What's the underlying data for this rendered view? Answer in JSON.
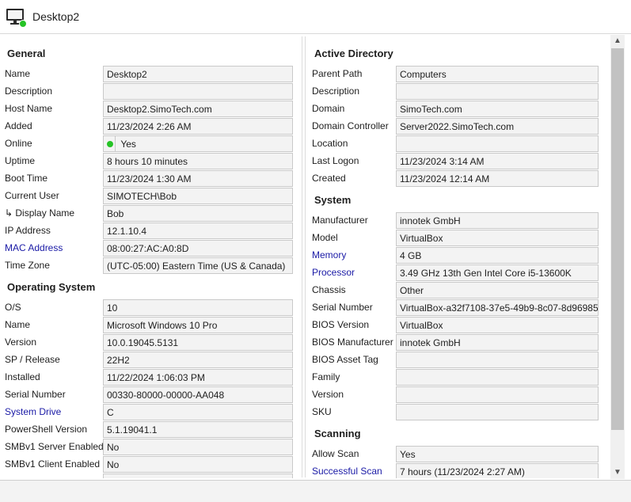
{
  "window": {
    "title": "Desktop2",
    "icon": "computer-online-icon"
  },
  "general": {
    "title": "General",
    "rows": [
      {
        "label": "Name",
        "value": "Desktop2"
      },
      {
        "label": "Description",
        "value": ""
      },
      {
        "label": "Host Name",
        "value": "Desktop2.SimoTech.com"
      },
      {
        "label": "Added",
        "value": "11/23/2024 2:26 AM"
      },
      {
        "label": "Online",
        "value": "Yes"
      },
      {
        "label": "Uptime",
        "value": "8 hours 10 minutes"
      },
      {
        "label": "Boot Time",
        "value": "11/23/2024 1:30 AM"
      },
      {
        "label": "Current User",
        "value": "SIMOTECH\\Bob"
      },
      {
        "label": "↳ Display Name",
        "value": "Bob"
      },
      {
        "label": "IP Address",
        "value": "12.1.10.4"
      },
      {
        "label": "MAC Address",
        "value": "08:00:27:AC:A0:8D"
      },
      {
        "label": "Time Zone",
        "value": "(UTC-05:00) Eastern Time (US & Canada)"
      }
    ]
  },
  "os": {
    "title": "Operating System",
    "rows": [
      {
        "label": "O/S",
        "value": "10"
      },
      {
        "label": "Name",
        "value": "Microsoft Windows 10 Pro"
      },
      {
        "label": "Version",
        "value": "10.0.19045.5131"
      },
      {
        "label": "SP / Release",
        "value": "22H2"
      },
      {
        "label": "Installed",
        "value": "11/22/2024 1:06:03 PM"
      },
      {
        "label": "Serial Number",
        "value": "00330-80000-00000-AA048"
      },
      {
        "label": "System Drive",
        "value": "C"
      },
      {
        "label": "PowerShell Version",
        "value": "5.1.19041.1"
      },
      {
        "label": "SMBv1 Server Enabled",
        "value": "No"
      },
      {
        "label": "SMBv1 Client Enabled",
        "value": "No"
      }
    ]
  },
  "active_directory": {
    "title": "Active Directory",
    "rows": [
      {
        "label": "Parent Path",
        "value": "Computers"
      },
      {
        "label": "Description",
        "value": ""
      },
      {
        "label": "Domain",
        "value": "SimoTech.com"
      },
      {
        "label": "Domain Controller",
        "value": "Server2022.SimoTech.com"
      },
      {
        "label": "Location",
        "value": ""
      },
      {
        "label": "Last Logon",
        "value": "11/23/2024 3:14 AM"
      },
      {
        "label": "Created",
        "value": "11/23/2024 12:14 AM"
      }
    ]
  },
  "system": {
    "title": "System",
    "rows": [
      {
        "label": "Manufacturer",
        "value": "innotek GmbH"
      },
      {
        "label": "Model",
        "value": "VirtualBox"
      },
      {
        "label": "Memory",
        "value": "4 GB"
      },
      {
        "label": "Processor",
        "value": "3.49 GHz 13th Gen Intel Core i5-13600K"
      },
      {
        "label": "Chassis",
        "value": "Other"
      },
      {
        "label": "Serial Number",
        "value": "VirtualBox-a32f7108-37e5-49b9-8c07-8d96985"
      },
      {
        "label": "BIOS Version",
        "value": "VirtualBox"
      },
      {
        "label": "BIOS Manufacturer",
        "value": "innotek GmbH"
      },
      {
        "label": "BIOS Asset Tag",
        "value": ""
      },
      {
        "label": "Family",
        "value": ""
      },
      {
        "label": "Version",
        "value": ""
      },
      {
        "label": "SKU",
        "value": ""
      }
    ]
  },
  "scanning": {
    "title": "Scanning",
    "rows": [
      {
        "label": "Allow Scan",
        "value": "Yes"
      },
      {
        "label": "Successful Scan",
        "value": "7 hours (11/23/2024 2:27 AM)"
      }
    ]
  },
  "scrollbar": {
    "up_icon": "▲",
    "down_icon": "▼"
  },
  "colors": {
    "link": "#1a1aa6",
    "online": "#26c326",
    "field_bg": "#f3f3f3"
  }
}
